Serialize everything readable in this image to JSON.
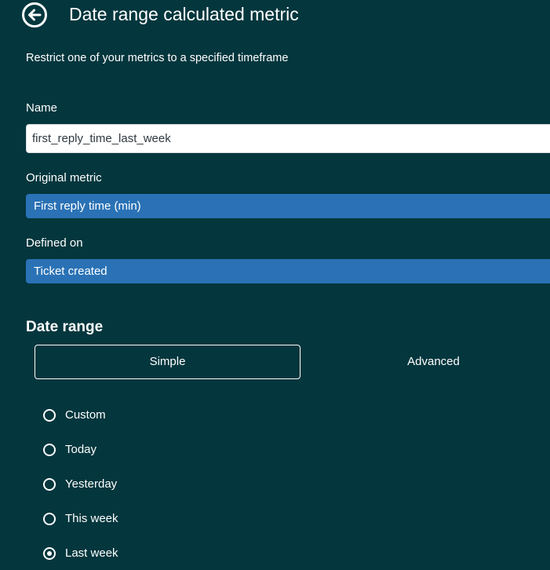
{
  "header": {
    "title": "Date range calculated metric",
    "subtitle": "Restrict one of your metrics to a specified timeframe",
    "back_icon": "arrow-left-circle-icon"
  },
  "form": {
    "name_label": "Name",
    "name_value": "first_reply_time_last_week",
    "original_metric_label": "Original metric",
    "original_metric_value": "First reply time (min)",
    "defined_on_label": "Defined on",
    "defined_on_value": "Ticket created"
  },
  "date_range": {
    "title": "Date range",
    "tabs": [
      {
        "label": "Simple",
        "selected": true
      },
      {
        "label": "Advanced",
        "selected": false
      }
    ],
    "options": [
      {
        "label": "Custom",
        "checked": false
      },
      {
        "label": "Today",
        "checked": false
      },
      {
        "label": "Yesterday",
        "checked": false
      },
      {
        "label": "This week",
        "checked": false
      },
      {
        "label": "Last week",
        "checked": true
      }
    ]
  },
  "colors": {
    "background": "#03363d",
    "select_fill": "#2a72b5",
    "text": "#ffffff"
  }
}
